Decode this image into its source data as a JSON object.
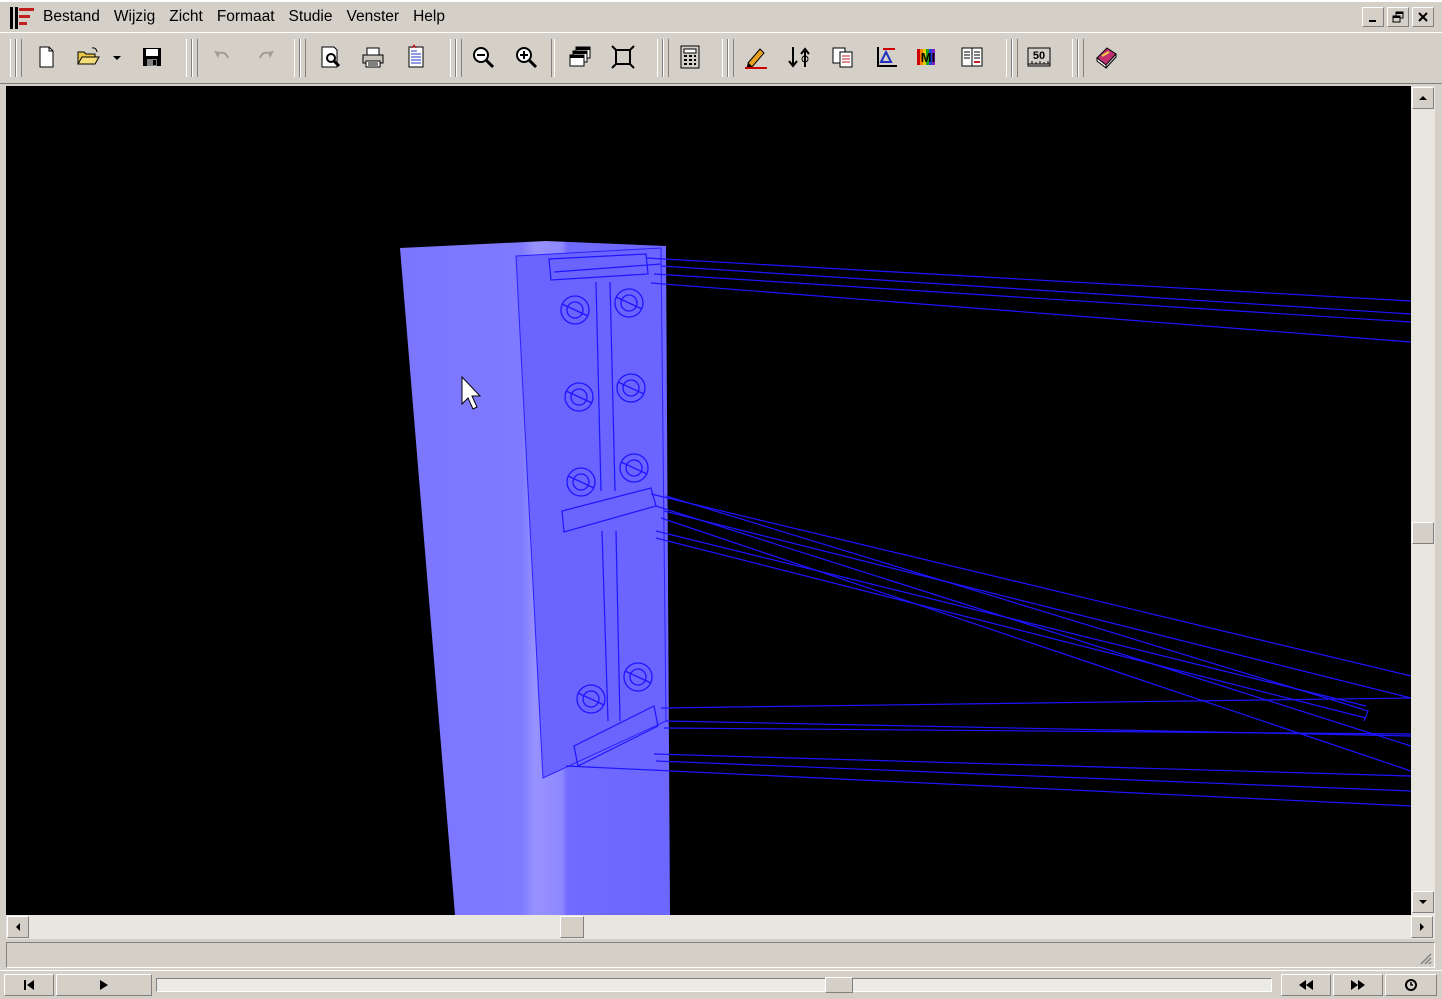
{
  "menubar": {
    "logo_icon": "application-logo-icon",
    "items": [
      "Bestand",
      "Wijzig",
      "Zicht",
      "Formaat",
      "Studie",
      "Venster",
      "Help"
    ]
  },
  "window_controls": [
    "minimize-icon",
    "restore-icon",
    "close-icon"
  ],
  "toolbar": {
    "buttons": [
      "new-document-icon",
      "open-folder-icon",
      "save-icon",
      "undo-icon",
      "redo-icon",
      "print-preview-icon",
      "print-icon",
      "report-icon",
      "zoom-out-icon",
      "zoom-in-icon",
      "windows-icon",
      "fit-view-icon",
      "calculator-icon",
      "pencil-edit-icon",
      "swap-icon",
      "copy-sheets-icon",
      "axis-icon",
      "material-icon",
      "compare-icon",
      "scale-50-icon",
      "help-book-icon"
    ],
    "scale_label": "50",
    "material_label": "MI"
  },
  "viewport": {
    "background": "#000000",
    "column_color": "#7a74ff",
    "wireframe_color": "#1616ff"
  },
  "statusbar": {
    "text": ""
  },
  "playback": {
    "buttons": [
      "skip-to-start-icon",
      "play-icon",
      "rewind-icon",
      "fast-forward-icon",
      "loop-icon"
    ],
    "position": 0.615
  }
}
